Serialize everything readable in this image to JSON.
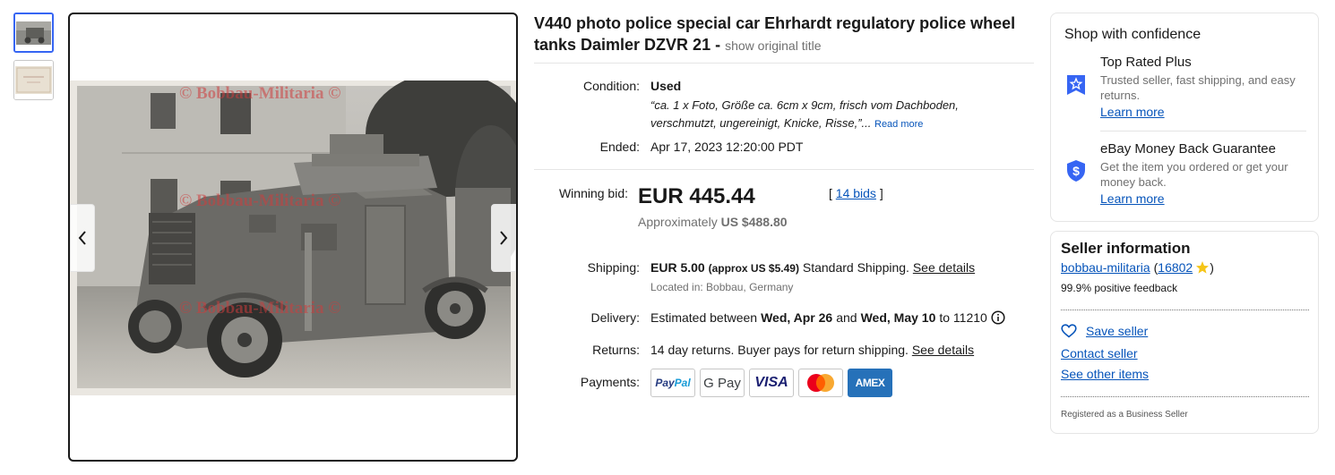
{
  "gallery": {
    "thumbnails": [
      "thumbnail-1",
      "thumbnail-2"
    ],
    "watermark_text": "© Bobbau-Militaria ©",
    "prev_icon": "chevron-left-icon",
    "next_icon": "chevron-right-icon"
  },
  "listing": {
    "title": "V440 photo police special car Ehrhardt regulatory police wheel tanks Daimler DZVR 21 -",
    "show_original_title": "show original title",
    "condition_label": "Condition:",
    "condition_value": "Used",
    "condition_quote_line1": "“ca. 1 x Foto, Größe ca. 6cm x 9cm, frisch vom Dachboden,",
    "condition_quote_line2": "verschmutzt, ungereinigt, Knicke, Risse,”...",
    "read_more": "Read more",
    "ended_label": "Ended:",
    "ended_value": "Apr 17, 2023 12:20:00 PDT",
    "winning_bid_label": "Winning bid:",
    "price": "EUR 445.44",
    "approx_prefix": "Approximately",
    "approx_value": "US $488.80",
    "bids_open": "[",
    "bids_link": "14 bids",
    "bids_close": "]",
    "shipping_label": "Shipping:",
    "shipping_cost": "EUR 5.00",
    "shipping_approx": "(approx US $5.49)",
    "shipping_method": "Standard Shipping.",
    "shipping_details": "See details",
    "located_in": "Located in: Bobbau, Germany",
    "delivery_label": "Delivery:",
    "delivery_prefix": "Estimated between",
    "delivery_start": "Wed, Apr 26",
    "delivery_and": "and",
    "delivery_end": "Wed, May 10",
    "delivery_to": "to 11210",
    "returns_label": "Returns:",
    "returns_text": "14 day returns. Buyer pays for return shipping.",
    "returns_details": "See details",
    "payments_label": "Payments:",
    "payment_methods": [
      "PayPal",
      "G Pay",
      "VISA",
      "Mastercard",
      "AMEX"
    ]
  },
  "confidence": {
    "heading": "Shop with confidence",
    "top_rated_title": "Top Rated Plus",
    "top_rated_desc": "Trusted seller, fast shipping, and easy returns.",
    "top_rated_link": "Learn more",
    "guarantee_title": "eBay Money Back Guarantee",
    "guarantee_desc": "Get the item you ordered or get your money back.",
    "guarantee_link": "Learn more"
  },
  "seller": {
    "heading": "Seller information",
    "name": "bobbau-militaria",
    "feedback_open": "(",
    "feedback_count": "16802",
    "feedback_close": ")",
    "positive_feedback": "99.9% positive feedback",
    "save_seller": "Save seller",
    "contact_seller": "Contact seller",
    "see_other_items": "See other items",
    "business_note": "Registered as a Business Seller"
  },
  "colors": {
    "link_blue": "#0654ba",
    "selected_thumb_border": "#3665f3",
    "badge_blue": "#3665f3",
    "amex_blue": "#2671b9",
    "star_gold": "#f5c518"
  }
}
